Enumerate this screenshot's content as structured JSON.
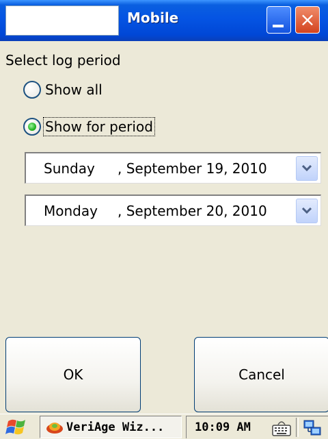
{
  "window": {
    "title": "Mobile",
    "minimize_glyph": "_",
    "close_glyph": "×"
  },
  "content": {
    "section_label": "Select log period",
    "radio_show_all": {
      "label": "Show all",
      "checked": false
    },
    "radio_show_period": {
      "label": "Show for period",
      "checked": true
    },
    "start_date": {
      "weekday": "Sunday",
      "rest": ", September 19, 2010"
    },
    "end_date": {
      "weekday": "Monday",
      "rest": ", September 20, 2010"
    }
  },
  "buttons": {
    "ok": "OK",
    "cancel": "Cancel"
  },
  "taskbar": {
    "start_icon": "windows-flag-icon",
    "task_label": "VeriAge Wiz...",
    "clock": "10:09 AM",
    "keyboard_icon": "keyboard-icon",
    "network_icon": "network-icon"
  },
  "colors": {
    "titlebar": "#0554e3",
    "close_button": "#d3431e",
    "radio_checked": "#22b422",
    "dropdown": "#c1d3fb",
    "background": "#ece9d8"
  }
}
